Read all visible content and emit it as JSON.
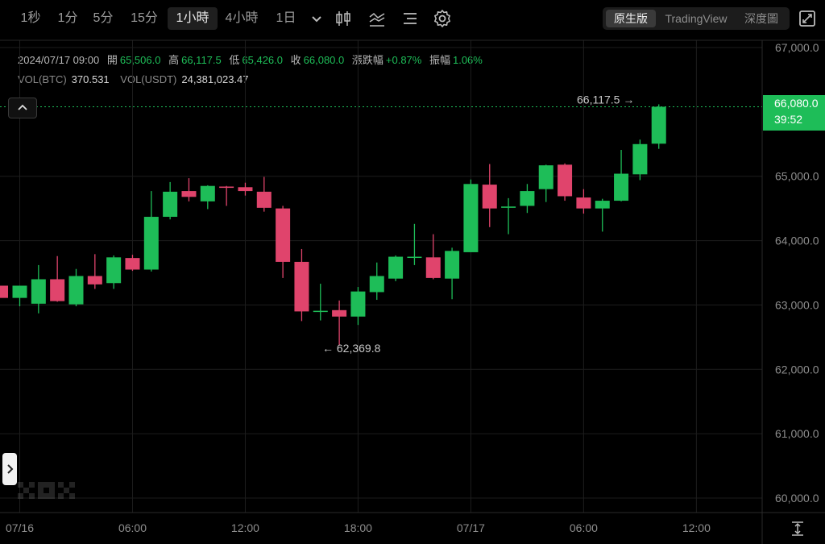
{
  "toolbar": {
    "timeframes": [
      "1秒",
      "1分",
      "5分",
      "15分",
      "1小時",
      "4小時",
      "1日"
    ],
    "active_timeframe": "1小時",
    "view_options": [
      "原生版",
      "TradingView",
      "深度圖"
    ],
    "active_view": "原生版"
  },
  "info": {
    "datetime": "2024/07/17 09:00",
    "open_label": "開",
    "open": "65,506.0",
    "high_label": "高",
    "high": "66,117.5",
    "low_label": "低",
    "low": "65,426.0",
    "close_label": "收",
    "close": "66,080.0",
    "change_label": "漲跌幅",
    "change": "+0.87%",
    "amplitude_label": "振幅",
    "amplitude": "1.06%",
    "vol_btc_label": "VOL(BTC)",
    "vol_btc": "370.531",
    "vol_usdt_label": "VOL(USDT)",
    "vol_usdt": "24,381,023.47"
  },
  "price_tag": {
    "price": "66,080.0",
    "countdown": "39:52"
  },
  "markers": {
    "high": "66,117.5",
    "low": "62,369.8"
  },
  "colors": {
    "up": "#1ebd58",
    "down": "#e0446c",
    "background": "#000000"
  },
  "chart_data": {
    "type": "candlestick",
    "y_ticks": [
      "67,000.0",
      "65,000.0",
      "64,000.0",
      "63,000.0",
      "62,000.0",
      "61,000.0",
      "60,000.0"
    ],
    "ylim": [
      59850,
      67100
    ],
    "x_ticks": [
      {
        "label": "07/16",
        "index": 0
      },
      {
        "label": "06:00",
        "index": 6
      },
      {
        "label": "12:00",
        "index": 12
      },
      {
        "label": "18:00",
        "index": 18
      },
      {
        "label": "07/17",
        "index": 24
      },
      {
        "label": "06:00",
        "index": 30
      },
      {
        "label": "12:00",
        "index": 36
      }
    ],
    "candles": [
      {
        "o": 63110,
        "h": 63300,
        "l": 62980,
        "c": 63300
      },
      {
        "o": 63020,
        "h": 63620,
        "l": 62870,
        "c": 63400
      },
      {
        "o": 63400,
        "h": 63760,
        "l": 63050,
        "c": 63060
      },
      {
        "o": 63010,
        "h": 63560,
        "l": 62980,
        "c": 63450
      },
      {
        "o": 63450,
        "h": 63790,
        "l": 63250,
        "c": 63320
      },
      {
        "o": 63340,
        "h": 63770,
        "l": 63250,
        "c": 63740
      },
      {
        "o": 63730,
        "h": 63780,
        "l": 63530,
        "c": 63550
      },
      {
        "o": 63550,
        "h": 64770,
        "l": 63520,
        "c": 64370
      },
      {
        "o": 64370,
        "h": 64910,
        "l": 64330,
        "c": 64760
      },
      {
        "o": 64770,
        "h": 64970,
        "l": 64610,
        "c": 64680
      },
      {
        "o": 64610,
        "h": 64860,
        "l": 64490,
        "c": 64850
      },
      {
        "o": 64840,
        "h": 64850,
        "l": 64540,
        "c": 64820
      },
      {
        "o": 64830,
        "h": 64900,
        "l": 64700,
        "c": 64770
      },
      {
        "o": 64760,
        "h": 64990,
        "l": 64450,
        "c": 64510
      },
      {
        "o": 64500,
        "h": 64540,
        "l": 63420,
        "c": 63670
      },
      {
        "o": 63670,
        "h": 63870,
        "l": 62750,
        "c": 62900
      },
      {
        "o": 62900,
        "h": 63330,
        "l": 62760,
        "c": 62910
      },
      {
        "o": 62920,
        "h": 63070,
        "l": 62370,
        "c": 62820
      },
      {
        "o": 62820,
        "h": 63280,
        "l": 62690,
        "c": 63210
      },
      {
        "o": 63200,
        "h": 63660,
        "l": 63080,
        "c": 63450
      },
      {
        "o": 63410,
        "h": 63770,
        "l": 63370,
        "c": 63750
      },
      {
        "o": 63750,
        "h": 64260,
        "l": 63620,
        "c": 63750
      },
      {
        "o": 63740,
        "h": 64100,
        "l": 63400,
        "c": 63420
      },
      {
        "o": 63410,
        "h": 63890,
        "l": 63090,
        "c": 63840
      },
      {
        "o": 63820,
        "h": 64950,
        "l": 63820,
        "c": 64880
      },
      {
        "o": 64870,
        "h": 65190,
        "l": 64210,
        "c": 64500
      },
      {
        "o": 64510,
        "h": 64660,
        "l": 64100,
        "c": 64530
      },
      {
        "o": 64540,
        "h": 64880,
        "l": 64430,
        "c": 64770
      },
      {
        "o": 64800,
        "h": 65180,
        "l": 64600,
        "c": 65170
      },
      {
        "o": 65180,
        "h": 65200,
        "l": 64620,
        "c": 64690
      },
      {
        "o": 64670,
        "h": 64800,
        "l": 64420,
        "c": 64500
      },
      {
        "o": 64500,
        "h": 64650,
        "l": 64140,
        "c": 64620
      },
      {
        "o": 64620,
        "h": 65410,
        "l": 64610,
        "c": 65040
      },
      {
        "o": 65030,
        "h": 65570,
        "l": 64940,
        "c": 65500
      },
      {
        "o": 65506,
        "h": 66117.5,
        "l": 65426,
        "c": 66080
      }
    ]
  }
}
